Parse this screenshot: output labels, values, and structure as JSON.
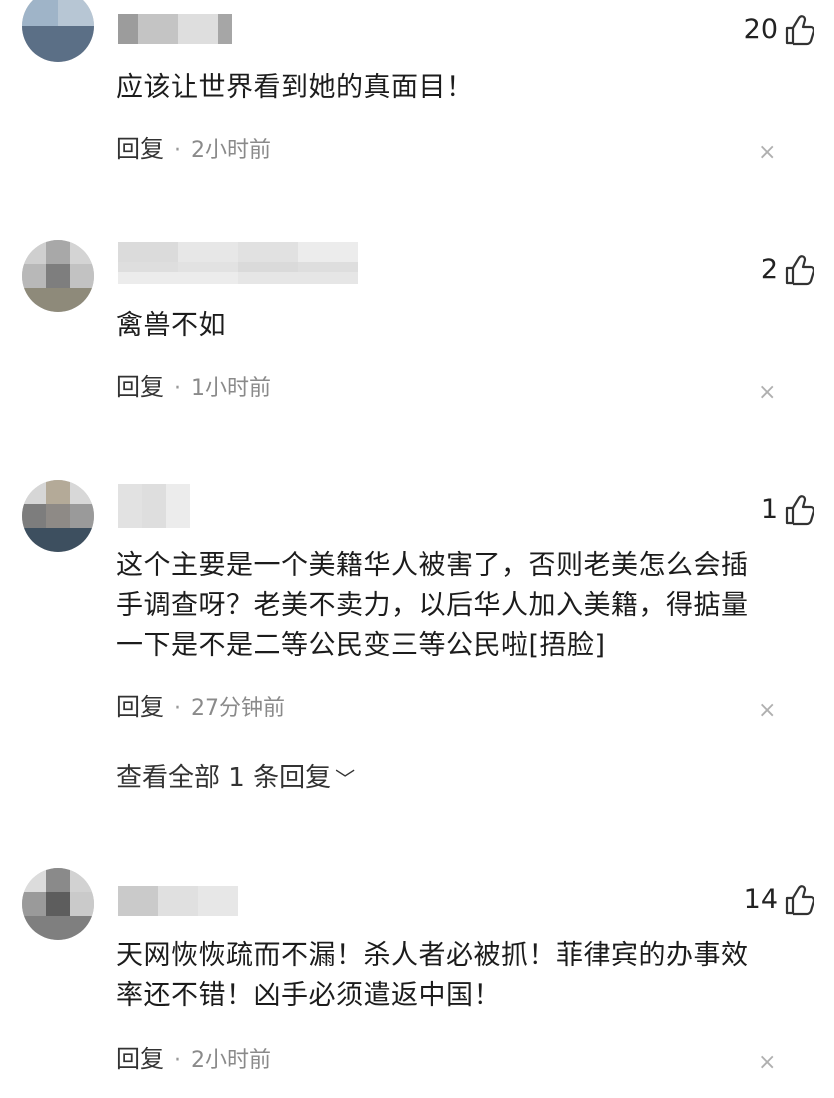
{
  "comments": [
    {
      "likes": "20",
      "text": "应该让世界看到她的真面目！",
      "reply_label": "回复",
      "time": "2小时前",
      "username_visible": "………… å"
    },
    {
      "likes": "2",
      "text": "禽兽不如",
      "reply_label": "回复",
      "time": "1小时前"
    },
    {
      "likes": "1",
      "text": "这个主要是一个美籍华人被害了，否则老美怎么会插手调查呀？老美不卖力，以后华人加入美籍，得掂量一下是不是二等公民变三等公民啦[捂脸]",
      "reply_label": "回复",
      "time": "27分钟前",
      "view_all": "查看全部 1 条回复"
    },
    {
      "likes": "14",
      "text": "天网恢恢疏而不漏！杀人者必被抓！菲律宾的办事效率还不错！凶手必须遣返中国！",
      "reply_label": "回复",
      "time": "2小时前"
    }
  ],
  "icons": {
    "like": "thumbs-up-icon",
    "close": "close-icon",
    "chevron": "chevron-down-icon"
  },
  "colors": {
    "text": "#1c1c1c",
    "meta": "#8a8a8a",
    "close": "#b0b0b0"
  }
}
